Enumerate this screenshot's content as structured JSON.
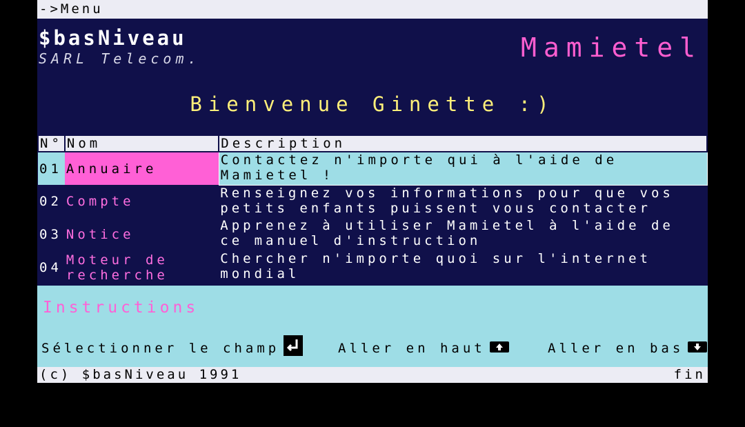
{
  "topbar": {
    "label": "->Menu"
  },
  "header": {
    "brand": "$basNiveau",
    "brand_sub": "SARL Telecom.",
    "product": "Mamietel",
    "welcome": "Bienvenue Ginette :)"
  },
  "table": {
    "headers": {
      "num": "N°",
      "name": "Nom",
      "desc": "Description"
    },
    "rows": [
      {
        "num": "01",
        "name": "Annuaire",
        "desc": "Contactez n'importe qui à l'aide de Mamietel !"
      },
      {
        "num": "02",
        "name": "Compte",
        "desc": "Renseignez vos informations pour que vos petits enfants puissent vous contacter"
      },
      {
        "num": "03",
        "name": "Notice",
        "desc": "Apprenez à utiliser Mamietel à l'aide de ce manuel d'instruction"
      },
      {
        "num": "04",
        "name": "Moteur de recherche",
        "desc": "Chercher n'importe quoi sur l'internet mondial"
      }
    ]
  },
  "instructions": {
    "title": "Instructions",
    "select_label": "Sélectionner le champ",
    "up_label": "Aller en haut",
    "down_label": "Aller en bas",
    "select_icon": "enter-key-icon",
    "up_icon": "arrow-up-key-icon",
    "down_icon": "arrow-down-key-icon"
  },
  "footer": {
    "copyright": "(c) $basNiveau 1991",
    "end": "fin"
  },
  "colors": {
    "background": "#10104a",
    "accent_pink": "#ff60d6",
    "welcome_yellow": "#fff07a",
    "panel_cyan": "#9edde6",
    "bar_light": "#ececf4"
  }
}
